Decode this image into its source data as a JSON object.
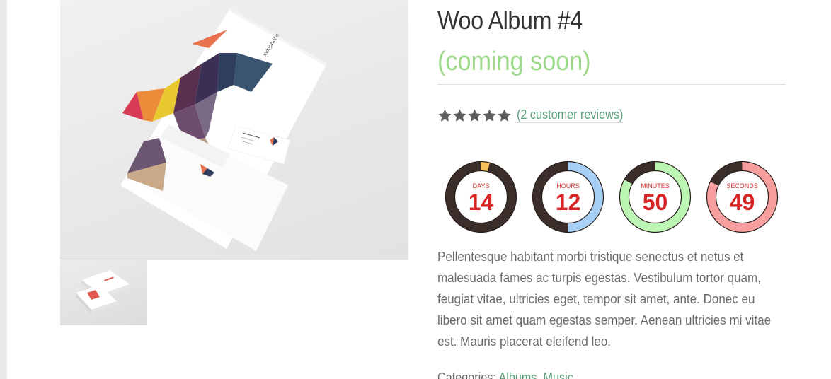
{
  "product": {
    "title": "Woo Album #4",
    "status": "(coming soon)",
    "rating": {
      "stars": 5,
      "max": 5,
      "reviews_link": "(2 customer reviews)"
    },
    "description": "Pellentesque habitant morbi tristique senectus et netus et malesuada fames ac turpis egestas. Vestibulum tortor quam, feugiat vitae, ultricies eget, tempor sit amet, ante. Donec eu libero sit amet quam egestas semper. Aenean ultricies mi vitae est. Mauris placerat eleifend leo.",
    "categories": {
      "label": "Categories:",
      "items": [
        "Albums",
        "Music"
      ]
    }
  },
  "countdown": [
    {
      "unit": "DAYS",
      "value": "14",
      "fraction": 0.04,
      "ring_color": "#f5c05a"
    },
    {
      "unit": "HOURS",
      "value": "12",
      "fraction": 0.5,
      "ring_color": "#a8d0f7"
    },
    {
      "unit": "MINUTES",
      "value": "50",
      "fraction": 0.83,
      "ring_color": "#bdf5b5"
    },
    {
      "unit": "SECONDS",
      "value": "49",
      "fraction": 0.82,
      "ring_color": "#f79f9f"
    }
  ],
  "gallery": {
    "brand_text": "xylophone"
  },
  "colors": {
    "accent_link": "#5aa07a",
    "coming_soon": "#9dd98a",
    "countdown_number": "#d72424",
    "ring_track": "#3a2d2a",
    "star": "#5f5f5f"
  }
}
